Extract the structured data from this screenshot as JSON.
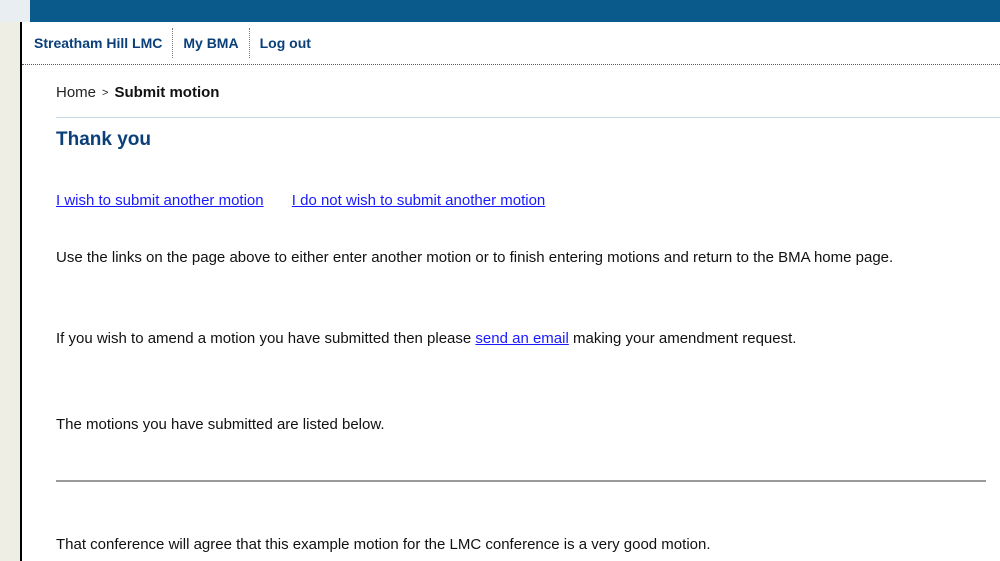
{
  "nav": {
    "items": [
      {
        "label": "Streatham Hill LMC"
      },
      {
        "label": "My BMA"
      },
      {
        "label": "Log out"
      }
    ]
  },
  "breadcrumb": {
    "home": "Home",
    "separator": ">",
    "current": "Submit motion"
  },
  "page": {
    "title": "Thank you"
  },
  "links": {
    "submit_another": "I wish to submit another motion",
    "no_submit_another": "I do not wish to submit another motion"
  },
  "content": {
    "para1": "Use the links on the page above to either enter another motion or to finish entering motions and return to the BMA home page.",
    "para2_before": "If you wish to amend a motion you have submitted then please ",
    "para2_link": "send an email",
    "para2_after": " making your amendment request.",
    "para3": "The motions you have submitted are listed below."
  },
  "motions": [
    {
      "text": "That conference will agree that this example motion for the LMC conference is a very good motion."
    }
  ],
  "colors": {
    "top_bar": "#0a5a8c",
    "nav_link": "#0a3f7a",
    "title": "#0a3f7a",
    "body_link": "#1a1aff"
  }
}
